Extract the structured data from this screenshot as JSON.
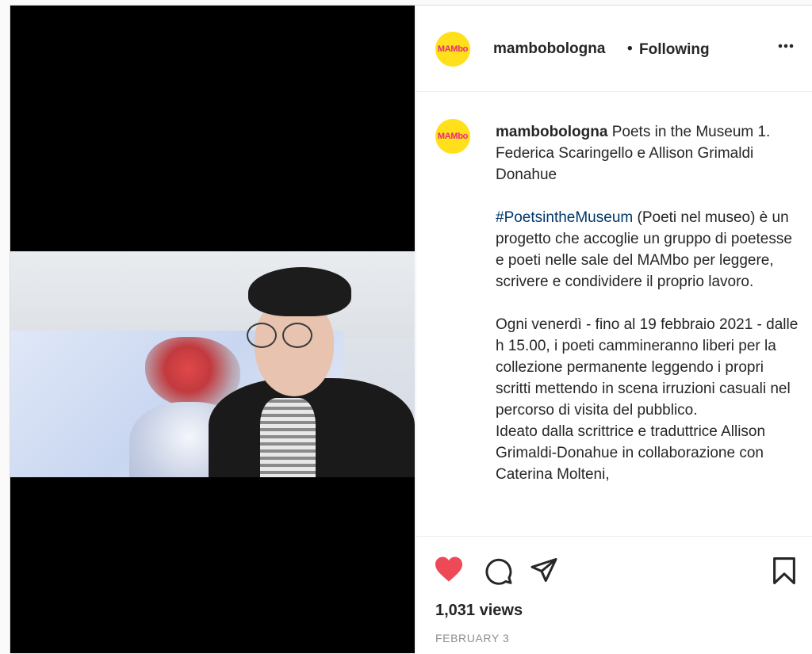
{
  "account": {
    "username": "mambobologna",
    "avatar_text": "MAMbo",
    "separator": "•",
    "follow_status": "Following",
    "more_icon": "more-horizontal-icon"
  },
  "caption": {
    "username": "mambobologna",
    "title": "Poets in the Museum 1. Federica Scaringello e Allison Grimaldi Donahue",
    "hashtag": "#PoetsintheMuseum",
    "paragraph1_rest": " (Poeti nel museo) è un progetto che accoglie un gruppo di poetesse e poeti nelle sale del MAMbo per leggere, scrivere e condividere il proprio lavoro.",
    "paragraph2": "Ogni venerdì - fino al 19 febbraio 2021 - dalle h 15.00, i poeti cammineranno liberi per la collezione permanente leggendo i propri scritti mettendo in scena irruzioni casuali nel percorso di visita del pubblico.",
    "paragraph3": "Ideato dalla scrittrice e traduttrice Allison Grimaldi-Donahue in collaborazione con Caterina Molteni,"
  },
  "actions": {
    "like_icon": "heart-filled-icon",
    "comment_icon": "comment-icon",
    "share_icon": "paper-plane-icon",
    "save_icon": "bookmark-icon",
    "like_color": "#ed4956"
  },
  "stats": {
    "views": "1,031 views",
    "date": "FEBRUARY 3"
  }
}
